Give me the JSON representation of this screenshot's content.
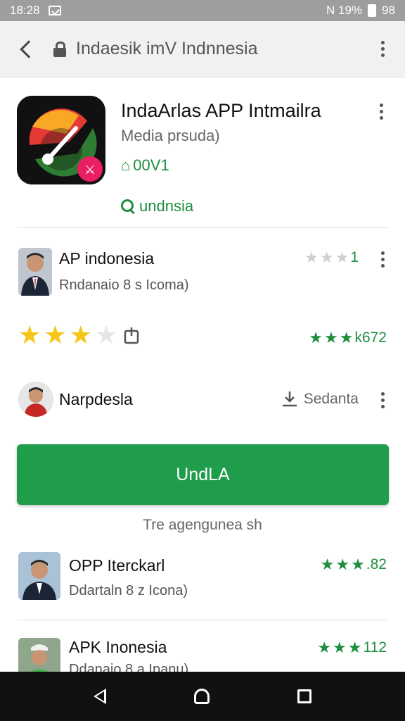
{
  "status_bar": {
    "time": "18:28",
    "right_text": "N 19%",
    "battery_text": "98"
  },
  "app_bar": {
    "url": "Indaesik imV Indnnesia"
  },
  "app": {
    "title": "IndaArlas APP Intmailra",
    "subtitle": "Media prsuda)",
    "code": "00V1",
    "search": "undnsia"
  },
  "review_1": {
    "name": "AP indonesia",
    "sub": "Rndanaio 8 s Icoma)",
    "rating_text": "1"
  },
  "rating_row": {
    "count_text": "k672"
  },
  "developer": {
    "name": "Narpdesla",
    "action": "Sedanta"
  },
  "install_button": {
    "label": "UndLA"
  },
  "caption": "Tre agengunea sh",
  "list": [
    {
      "name": "OPP Iterckarl",
      "sub": "Ddartaln 8 z Icona)",
      "rating_text": ".82"
    },
    {
      "name": "APK Inonesia",
      "sub": "Ddanaio 8 a Ipanu)",
      "rating_text": "112"
    }
  ],
  "colors": {
    "accent_green": "#1f9d4b",
    "status_bar": "#9e9e9e",
    "nav_bar": "#111111"
  },
  "icons": [
    "back-arrow-icon",
    "lock-icon",
    "more-vert-icon",
    "search-icon",
    "download-icon",
    "share-icon",
    "star-icon"
  ]
}
